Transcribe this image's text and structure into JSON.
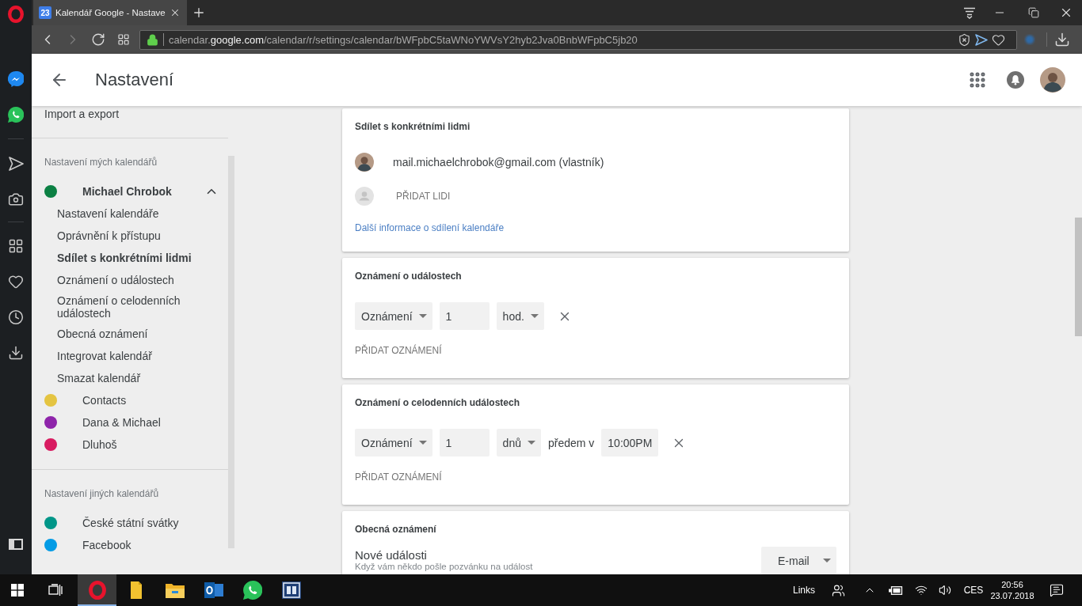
{
  "browser": {
    "tabs": [
      {
        "badge": "23",
        "title": "Kalendář Google - Nastave",
        "selected": true
      }
    ],
    "url": {
      "host_prefix": "calendar.",
      "host_domain": "google.com",
      "path": "/calendar/r/settings/calendar/bWFpbC5taWNoYWVsY2hyb2Jva0BnbWFpbC5jb20"
    }
  },
  "header": {
    "title": "Nastavení"
  },
  "sidebar": {
    "top_item": "Import a export",
    "sections": [
      {
        "heading": "Nastavení mých kalendářů",
        "calendars": [
          {
            "name": "Michael Chrobok",
            "color": "#0b8043",
            "expanded": true,
            "children": [
              {
                "label": "Nastavení kalendáře",
                "selected": false
              },
              {
                "label": "Oprávnění k přístupu",
                "selected": false
              },
              {
                "label": "Sdílet s konkrétními lidmi",
                "selected": true
              },
              {
                "label": "Oznámení o událostech",
                "selected": false
              },
              {
                "label": "Oznámení o celodenních událostech",
                "selected": false
              },
              {
                "label": "Obecná oznámení",
                "selected": false
              },
              {
                "label": "Integrovat kalendář",
                "selected": false
              },
              {
                "label": "Smazat kalendář",
                "selected": false
              }
            ]
          },
          {
            "name": "Contacts",
            "color": "#e4c441",
            "expanded": false
          },
          {
            "name": "Dana & Michael",
            "color": "#8e24aa",
            "expanded": false
          },
          {
            "name": "Dluhoš",
            "color": "#d81b60",
            "expanded": false
          }
        ]
      },
      {
        "heading": "Nastavení jiných kalendářů",
        "calendars": [
          {
            "name": "České státní svátky",
            "color": "#009688",
            "expanded": false
          },
          {
            "name": "Facebook",
            "color": "#039be5",
            "expanded": false
          }
        ]
      }
    ]
  },
  "cards": [
    {
      "kind": "sharing",
      "title": "Sdílet s konkrétními lidmi",
      "people": [
        {
          "email": "mail.michaelchrobok@gmail.com (vlastník)"
        }
      ],
      "add_label": "PŘIDAT LIDI",
      "link": "Další informace o sdílení kalendáře"
    },
    {
      "kind": "notifications",
      "title": "Oznámení o událostech",
      "rows": [
        {
          "method": "Oznámení",
          "amount": "1",
          "unit": "hod."
        }
      ],
      "add_label": "PŘIDAT OZNÁMENÍ"
    },
    {
      "kind": "notifications",
      "title": "Oznámení o celodenních událostech",
      "rows": [
        {
          "method": "Oznámení",
          "amount": "1",
          "unit": "dnů",
          "before_label": "předem v",
          "time": "10:00PM"
        }
      ],
      "add_label": "PŘIDAT OZNÁMENÍ"
    },
    {
      "kind": "general",
      "title": "Obecná oznámení",
      "settings": [
        {
          "label": "Nové události",
          "description": "Když vám někdo pošle pozvánku na událost",
          "value": "E-mail"
        }
      ]
    }
  ],
  "taskbar": {
    "apps": [
      {
        "selected": true
      },
      {
        "selected": false
      },
      {
        "selected": false
      },
      {
        "selected": false
      },
      {
        "selected": false
      },
      {
        "selected": false
      }
    ],
    "links_label": "Links",
    "language": "CES",
    "time": "20:56",
    "date": "23.07.2018"
  }
}
